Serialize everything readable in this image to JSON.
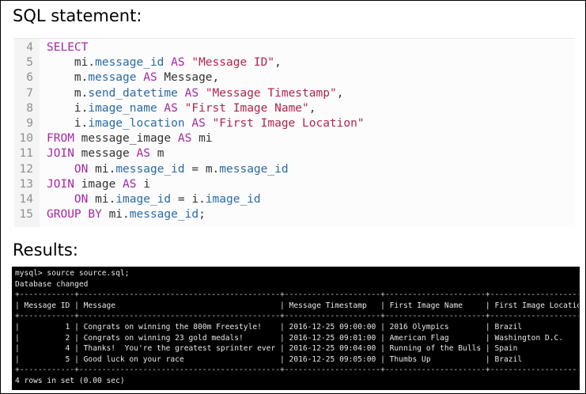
{
  "headings": {
    "sql": "SQL statement:",
    "results": "Results:"
  },
  "colors": {
    "keyword": "#a626a4",
    "column": "#2a6aa6",
    "string": "#b0254a",
    "text": "#333333",
    "line_number": "#8f8f8f",
    "terminal_bg": "#000000",
    "terminal_fg": "#e8e8e8"
  },
  "code": {
    "lines": [
      {
        "num": "4",
        "tokens": [
          {
            "c": "kw",
            "t": "SELECT"
          }
        ]
      },
      {
        "num": "5",
        "tokens": [
          {
            "c": "tk",
            "t": "    mi."
          },
          {
            "c": "col",
            "t": "message_id"
          },
          {
            "c": "kw",
            "t": " AS "
          },
          {
            "c": "str",
            "t": "\"Message ID\""
          },
          {
            "c": "tk",
            "t": ","
          }
        ]
      },
      {
        "num": "6",
        "tokens": [
          {
            "c": "tk",
            "t": "    m."
          },
          {
            "c": "col",
            "t": "message"
          },
          {
            "c": "kw",
            "t": " AS "
          },
          {
            "c": "tk",
            "t": "Message,"
          }
        ]
      },
      {
        "num": "7",
        "tokens": [
          {
            "c": "tk",
            "t": "    m."
          },
          {
            "c": "col",
            "t": "send_datetime"
          },
          {
            "c": "kw",
            "t": " AS "
          },
          {
            "c": "str",
            "t": "\"Message Timestamp\""
          },
          {
            "c": "tk",
            "t": ","
          }
        ]
      },
      {
        "num": "8",
        "tokens": [
          {
            "c": "tk",
            "t": "    i."
          },
          {
            "c": "col",
            "t": "image_name"
          },
          {
            "c": "kw",
            "t": " AS "
          },
          {
            "c": "str",
            "t": "\"First Image Name\""
          },
          {
            "c": "tk",
            "t": ","
          }
        ]
      },
      {
        "num": "9",
        "tokens": [
          {
            "c": "tk",
            "t": "    i."
          },
          {
            "c": "col",
            "t": "image_location"
          },
          {
            "c": "kw",
            "t": " AS "
          },
          {
            "c": "str",
            "t": "\"First Image Location\""
          }
        ]
      },
      {
        "num": "10",
        "tokens": [
          {
            "c": "kw",
            "t": "FROM"
          },
          {
            "c": "tk",
            "t": " message_image "
          },
          {
            "c": "kw",
            "t": "AS"
          },
          {
            "c": "tk",
            "t": " mi"
          }
        ]
      },
      {
        "num": "11",
        "tokens": [
          {
            "c": "kw",
            "t": "JOIN"
          },
          {
            "c": "tk",
            "t": " message "
          },
          {
            "c": "kw",
            "t": "AS"
          },
          {
            "c": "tk",
            "t": " m"
          }
        ]
      },
      {
        "num": "12",
        "tokens": [
          {
            "c": "kw",
            "t": "    ON"
          },
          {
            "c": "tk",
            "t": " mi."
          },
          {
            "c": "col",
            "t": "message_id"
          },
          {
            "c": "tk",
            "t": " = m."
          },
          {
            "c": "col",
            "t": "message_id"
          }
        ]
      },
      {
        "num": "13",
        "tokens": [
          {
            "c": "kw",
            "t": "JOIN"
          },
          {
            "c": "tk",
            "t": " image "
          },
          {
            "c": "kw",
            "t": "AS"
          },
          {
            "c": "tk",
            "t": " i"
          }
        ]
      },
      {
        "num": "14",
        "tokens": [
          {
            "c": "kw",
            "t": "    ON"
          },
          {
            "c": "tk",
            "t": " mi."
          },
          {
            "c": "col",
            "t": "image_id"
          },
          {
            "c": "tk",
            "t": " = i."
          },
          {
            "c": "col",
            "t": "image_id"
          }
        ]
      },
      {
        "num": "15",
        "tokens": [
          {
            "c": "kw",
            "t": "GROUP BY"
          },
          {
            "c": "tk",
            "t": " mi."
          },
          {
            "c": "col",
            "t": "message_id"
          },
          {
            "c": "tk",
            "t": ";"
          }
        ]
      }
    ]
  },
  "terminal": {
    "command": "mysql> source source.sql;",
    "status": "Database changed",
    "columns": [
      "Message ID",
      "Message",
      "Message Timestamp",
      "First Image Name",
      "First Image Location"
    ],
    "rows": [
      [
        "1",
        "Congrats on winning the 800m Freestyle!",
        "2016-12-25 09:00:00",
        "2016 Olympics",
        "Brazil"
      ],
      [
        "2",
        "Congrats on winning 23 gold medals!",
        "2016-12-25 09:01:00",
        "American Flag",
        "Washington D.C."
      ],
      [
        "4",
        "Thanks!  You're the greatest sprinter ever",
        "2016-12-25 09:04:00",
        "Running of the Bulls",
        "Spain"
      ],
      [
        "5",
        "Good luck on your race",
        "2016-12-25 09:05:00",
        "Thumbs Up",
        "Brazil"
      ]
    ],
    "footer": "4 rows in set (0.00 sec)"
  }
}
